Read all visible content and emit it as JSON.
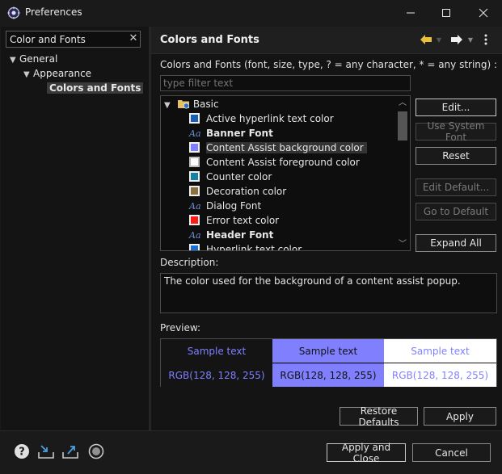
{
  "window": {
    "title": "Preferences"
  },
  "left": {
    "search_value": "Color and Fonts",
    "tree": [
      {
        "label": "General",
        "level": 0
      },
      {
        "label": "Appearance",
        "level": 1
      },
      {
        "label": "Colors and Fonts",
        "level": 2,
        "selected": true
      }
    ]
  },
  "page": {
    "title": "Colors and Fonts",
    "instructions": "Colors and Fonts (font, size, type, ? = any character, * = any string) :",
    "filter_placeholder": "type filter text",
    "category": "Basic",
    "items": [
      {
        "label": "Active hyperlink text color",
        "kind": "color",
        "color": "#1a5fb4"
      },
      {
        "label": "Banner Font",
        "kind": "font",
        "bold": true
      },
      {
        "label": "Content Assist background color",
        "kind": "color",
        "color": "#8080ff",
        "selected": true
      },
      {
        "label": "Content Assist foreground color",
        "kind": "color",
        "color": "#ffffff"
      },
      {
        "label": "Counter color",
        "kind": "color",
        "color": "#1a7fa0"
      },
      {
        "label": "Decoration color",
        "kind": "color",
        "color": "#8b7040"
      },
      {
        "label": "Dialog Font",
        "kind": "font"
      },
      {
        "label": "Error text color",
        "kind": "color",
        "color": "#ff1a1a"
      },
      {
        "label": "Header Font",
        "kind": "font",
        "bold": true
      },
      {
        "label": "Hyperlink text color",
        "kind": "color",
        "color": "#1a6fd0"
      }
    ],
    "buttons": {
      "edit": "Edit...",
      "use_system_font": "Use System Font",
      "reset": "Reset",
      "edit_default": "Edit Default...",
      "go_to_default": "Go to Default",
      "expand_all": "Expand All"
    },
    "description_label": "Description:",
    "description": "The color used for the background of a content assist popup.",
    "preview_label": "Preview:",
    "preview": {
      "sample": "Sample text",
      "rgb": "RGB(128, 128, 255)"
    },
    "restore_defaults": "Restore Defaults",
    "apply": "Apply"
  },
  "footer": {
    "apply_and_close": "Apply and Close",
    "cancel": "Cancel"
  },
  "colors": {
    "accent": "#8080ff",
    "background": "#141414"
  }
}
